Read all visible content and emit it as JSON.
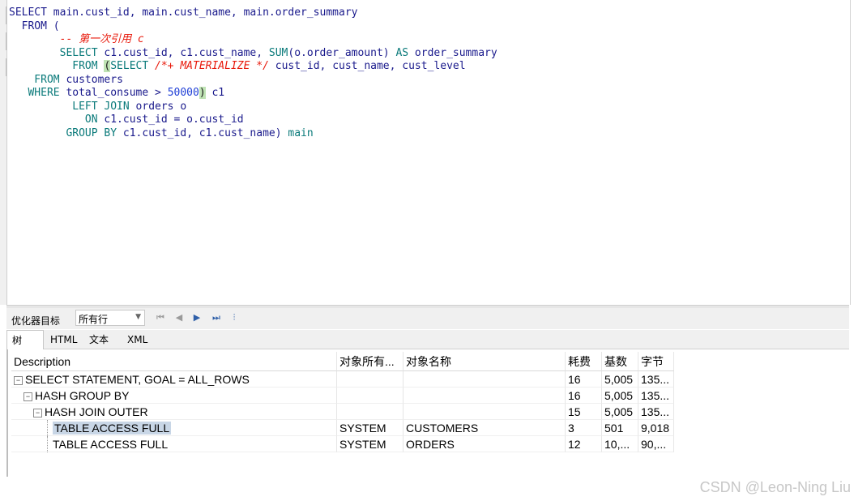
{
  "editor": {
    "lines": [
      {
        "parts": [
          {
            "t": "SELECT main.cust_id, main.cust_name, main.order_summary",
            "c": "kw"
          }
        ]
      },
      {
        "parts": [
          {
            "t": "  FROM (",
            "c": "kw"
          }
        ]
      },
      {
        "parts": [
          {
            "t": "        -- 第一次引用 c",
            "c": "cm"
          }
        ]
      },
      {
        "parts": [
          {
            "t": "        SELECT ",
            "c": "kw2"
          },
          {
            "t": "c1.cust_id, c1.cust_name, ",
            "c": "kw"
          },
          {
            "t": "SUM",
            "c": "kw2"
          },
          {
            "t": "(o.order_amount) ",
            "c": "kw"
          },
          {
            "t": "AS",
            "c": "kw2"
          },
          {
            "t": " order_summary",
            "c": "kw"
          }
        ]
      },
      {
        "parts": [
          {
            "t": "          FROM ",
            "c": "kw2"
          },
          {
            "t": "(",
            "c": "paren-hl"
          },
          {
            "t": "SELECT ",
            "c": "kw2"
          },
          {
            "t": "/*+ MATERIALIZE */",
            "c": "cm"
          },
          {
            "t": " cust_id, cust_name, cust_level",
            "c": "kw"
          }
        ]
      },
      {
        "parts": [
          {
            "t": "    FROM ",
            "c": "kw2"
          },
          {
            "t": "customers",
            "c": "kw"
          }
        ]
      },
      {
        "parts": [
          {
            "t": "   WHERE ",
            "c": "kw2"
          },
          {
            "t": "total_consume > ",
            "c": "kw"
          },
          {
            "t": "50000",
            "c": "num"
          },
          {
            "t": ")",
            "c": "paren-hl"
          },
          {
            "t": " c1",
            "c": "kw"
          }
        ]
      },
      {
        "parts": [
          {
            "t": "          LEFT JOIN ",
            "c": "kw2"
          },
          {
            "t": "orders o",
            "c": "kw"
          }
        ]
      },
      {
        "parts": [
          {
            "t": "            ON ",
            "c": "kw2"
          },
          {
            "t": "c1.cust_id = o.cust_id",
            "c": "kw"
          }
        ]
      },
      {
        "parts": [
          {
            "t": "         GROUP BY ",
            "c": "kw2"
          },
          {
            "t": "c1.cust_id, c1.cust_name) ",
            "c": "kw"
          },
          {
            "t": "main",
            "c": "kw2"
          }
        ]
      }
    ]
  },
  "toolbar": {
    "optimizer_label": "优化器目标",
    "optimizer_value": "所有行",
    "nav": [
      "⏮",
      "◀",
      "▶",
      "⏭",
      "⫶"
    ]
  },
  "tabs": [
    {
      "label": "树",
      "selected": true
    },
    {
      "label": "HTML",
      "selected": false
    },
    {
      "label": "文本",
      "selected": false
    },
    {
      "label": "XML",
      "selected": false
    }
  ],
  "plan": {
    "headers": [
      "Description",
      "对象所有...",
      "对象名称",
      "耗费",
      "基数",
      "字节"
    ],
    "rows": [
      {
        "indent": 0,
        "expander": "⊟",
        "desc": "SELECT STATEMENT, GOAL = ALL_ROWS",
        "owner": "",
        "name": "",
        "cost": "16",
        "card": "5,005",
        "bytes": "135..."
      },
      {
        "indent": 1,
        "expander": "⊟",
        "desc": "HASH GROUP BY",
        "owner": "",
        "name": "",
        "cost": "16",
        "card": "5,005",
        "bytes": "135..."
      },
      {
        "indent": 2,
        "expander": "⊟",
        "desc": "HASH JOIN OUTER",
        "owner": "",
        "name": "",
        "cost": "15",
        "card": "5,005",
        "bytes": "135..."
      },
      {
        "indent": 3,
        "expander": "",
        "desc": "TABLE ACCESS FULL",
        "owner": "SYSTEM",
        "name": "CUSTOMERS",
        "cost": "3",
        "card": "501",
        "bytes": "9,018",
        "selected": true
      },
      {
        "indent": 3,
        "expander": "",
        "desc": "TABLE ACCESS FULL",
        "owner": "SYSTEM",
        "name": "ORDERS",
        "cost": "12",
        "card": "10,...",
        "bytes": "90,..."
      }
    ]
  },
  "watermark": "CSDN @Leon-Ning Liu"
}
